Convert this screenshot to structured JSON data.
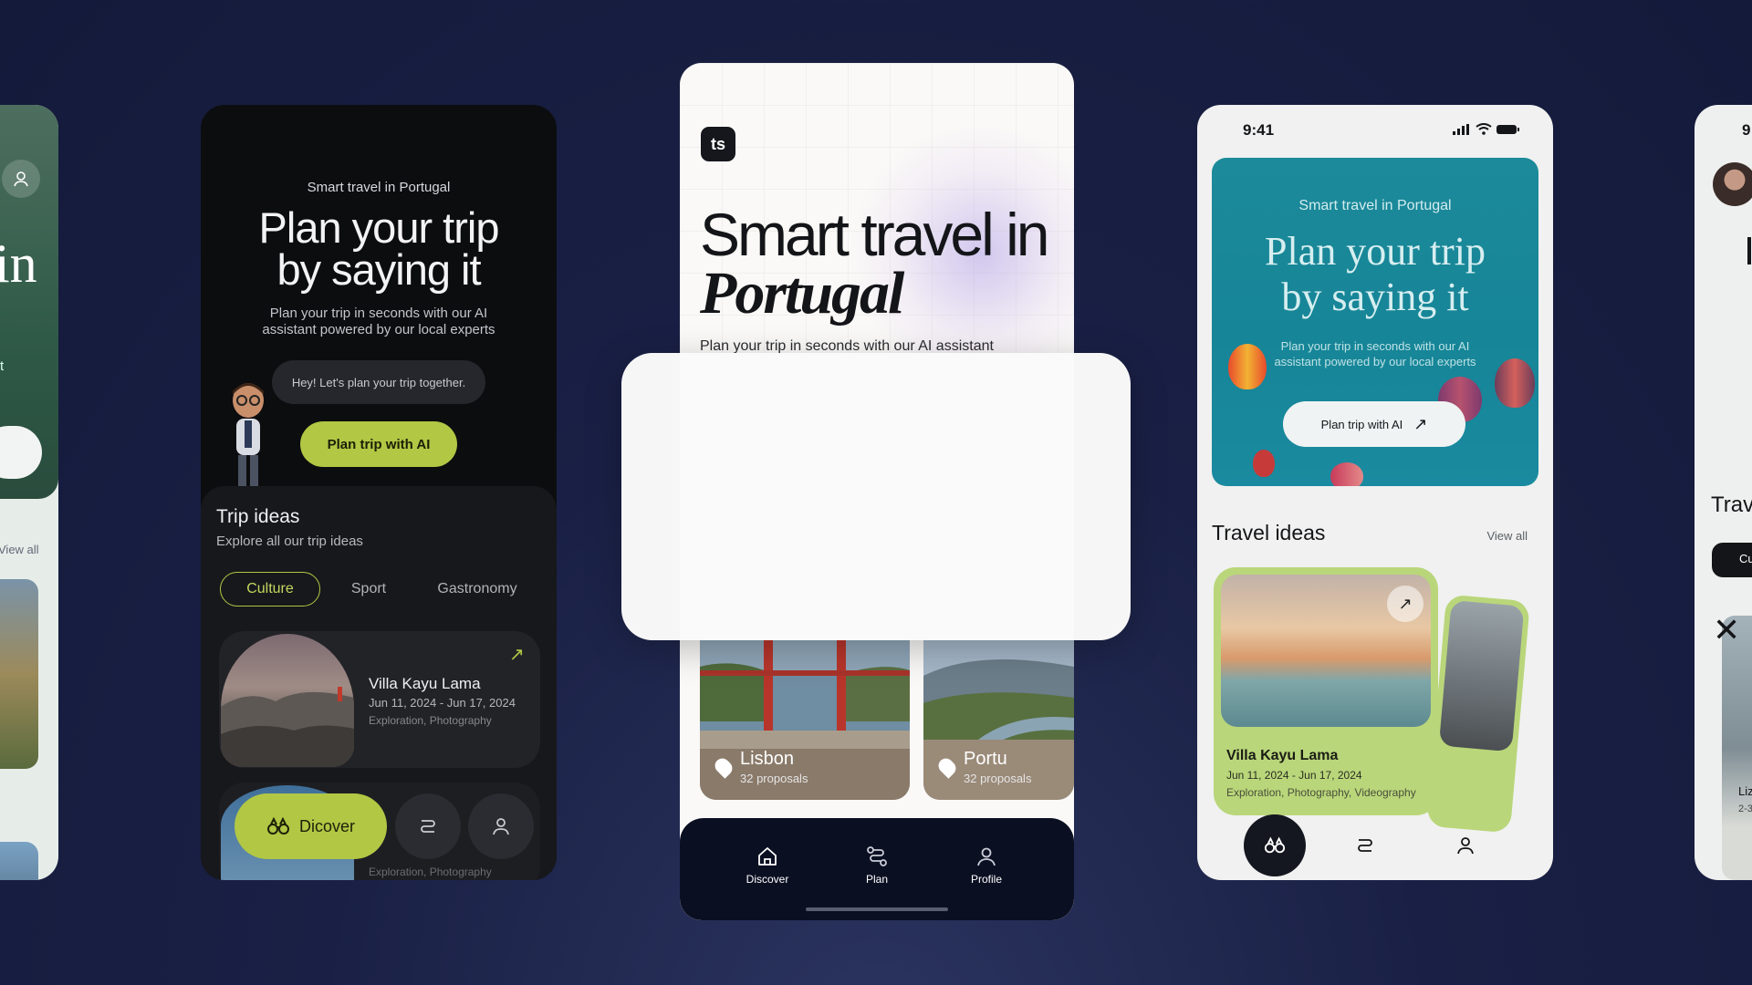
{
  "left_partial": {
    "big_text": "in",
    "small_text": "t",
    "view_all": "View all"
  },
  "dark_phone": {
    "kicker": "Smart travel in Portugal",
    "title_line1": "Plan your trip",
    "title_line2": "by saying it",
    "subtitle_line1": "Plan your trip in seconds with our AI",
    "subtitle_line2": "assistant powered by our local experts",
    "bubble": "Hey! Let's plan your trip together.",
    "plan_button": "Plan trip with AI",
    "ideas_title": "Trip ideas",
    "ideas_subtitle": "Explore all our trip ideas",
    "chips": [
      {
        "label": "Culture",
        "active": true
      },
      {
        "label": "Sport",
        "active": false
      },
      {
        "label": "Gastronomy",
        "active": false
      }
    ],
    "card": {
      "name": "Villa Kayu Lama",
      "dates": "Jun 11, 2024 - Jun 17, 2024",
      "tags": "Exploration, Photography"
    },
    "card2_tags": "Exploration, Photography",
    "nav": {
      "discover": "Dicover"
    }
  },
  "center_phone": {
    "logo": "ts",
    "title_line1": "Smart travel in",
    "title_line2": "Portugal",
    "subtitle": "Plan your trip in seconds with our AI assistant",
    "cities": [
      {
        "name": "Lisbon",
        "count": "32 proposals"
      },
      {
        "name": "Portu",
        "count": "32 proposals"
      }
    ],
    "nav": [
      {
        "label": "Discover",
        "icon": "home-icon"
      },
      {
        "label": "Plan",
        "icon": "route-icon"
      },
      {
        "label": "Profile",
        "icon": "user-icon"
      }
    ]
  },
  "right_phone": {
    "time": "9:41",
    "kicker": "Smart travel in Portugal",
    "title_line1": "Plan your trip",
    "title_line2": "by saying it",
    "subtitle_line1": "Plan your trip in seconds with our AI",
    "subtitle_line2": "assistant powered by our local experts",
    "plan_button": "Plan trip with AI",
    "ideas_title": "Travel ideas",
    "view_all": "View all",
    "card": {
      "name": "Villa Kayu Lama",
      "dates": "Jun 11, 2024 - Jun 17, 2024",
      "tags": "Exploration, Photography, Videography"
    }
  },
  "far_right_partial": {
    "time": "9",
    "title": "Trav",
    "chip": "Cu",
    "name": "Liz",
    "dates": "2-3"
  },
  "colors": {
    "lime_accent": "#b2c744",
    "teal_hero": "#168597",
    "navy_nav": "#0b0f22"
  }
}
